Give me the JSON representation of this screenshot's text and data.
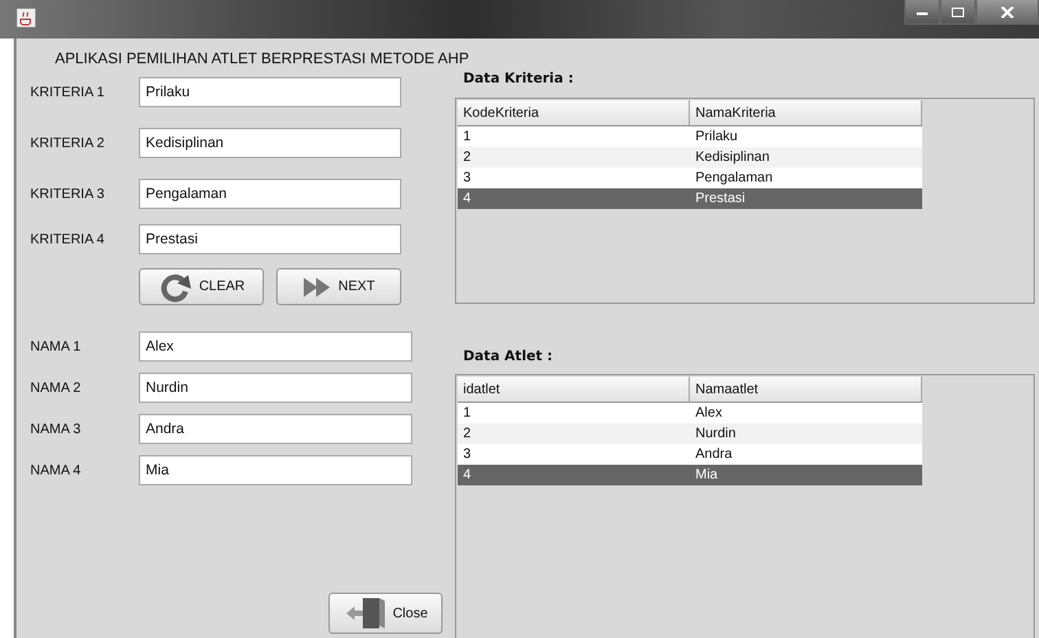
{
  "window": {
    "title": "APLIKASI PEMILIHAN ATLET BERPRESTASI METODE AHP"
  },
  "kriteria_fields": [
    {
      "label": "KRITERIA 1",
      "value": "Prilaku"
    },
    {
      "label": "KRITERIA 2",
      "value": "Kedisiplinan"
    },
    {
      "label": "KRITERIA 3",
      "value": "Pengalaman"
    },
    {
      "label": "KRITERIA 4",
      "value": "Prestasi"
    }
  ],
  "kriteria_buttons": [
    {
      "kind": "clear",
      "label": "CLEAR"
    },
    {
      "kind": "next",
      "label": "NEXT"
    }
  ],
  "nama_fields": [
    {
      "label": "NAMA 1",
      "value": "Alex"
    },
    {
      "label": "NAMA 2",
      "value": "Nurdin"
    },
    {
      "label": "NAMA 3",
      "value": "Andra"
    },
    {
      "label": "NAMA 4",
      "value": "Mia"
    }
  ],
  "close_button": {
    "label": "Close"
  },
  "tables": [
    {
      "title": "Data Kriteria :",
      "columns": [
        "KodeKriteria",
        "NamaKriteria"
      ],
      "rows": [
        {
          "cells": [
            "1",
            "Prilaku"
          ],
          "selected": false
        },
        {
          "cells": [
            "2",
            "Kedisiplinan"
          ],
          "selected": false
        },
        {
          "cells": [
            "3",
            "Pengalaman"
          ],
          "selected": false
        },
        {
          "cells": [
            "4",
            "Prestasi"
          ],
          "selected": true
        }
      ]
    },
    {
      "title": "Data Atlet :",
      "columns": [
        "idatlet",
        "Namaatlet"
      ],
      "rows": [
        {
          "cells": [
            "1",
            "Alex"
          ],
          "selected": false
        },
        {
          "cells": [
            "2",
            "Nurdin"
          ],
          "selected": false
        },
        {
          "cells": [
            "3",
            "Andra"
          ],
          "selected": false
        },
        {
          "cells": [
            "4",
            "Mia"
          ],
          "selected": true
        }
      ]
    }
  ]
}
